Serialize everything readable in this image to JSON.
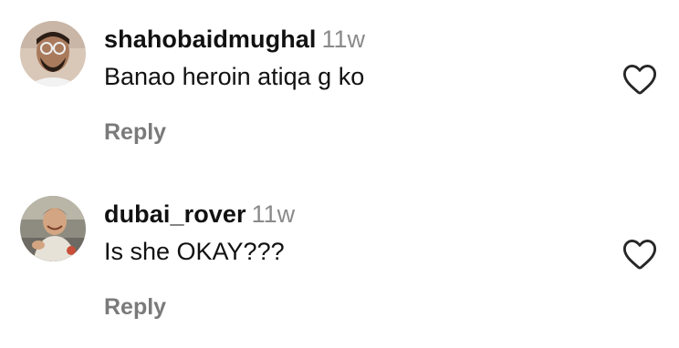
{
  "comments": [
    {
      "username": "shahobaidmughal",
      "time": "11w",
      "text": "Banao heroin atiqa g ko",
      "reply_label": "Reply"
    },
    {
      "username": "dubai_rover",
      "time": "11w",
      "text": "Is she OKAY???",
      "reply_label": "Reply"
    }
  ],
  "icons": {
    "like": "heart-outline-icon"
  },
  "colors": {
    "text": "#111111",
    "muted": "#8a8a8a",
    "reply": "#7a7a7a"
  }
}
